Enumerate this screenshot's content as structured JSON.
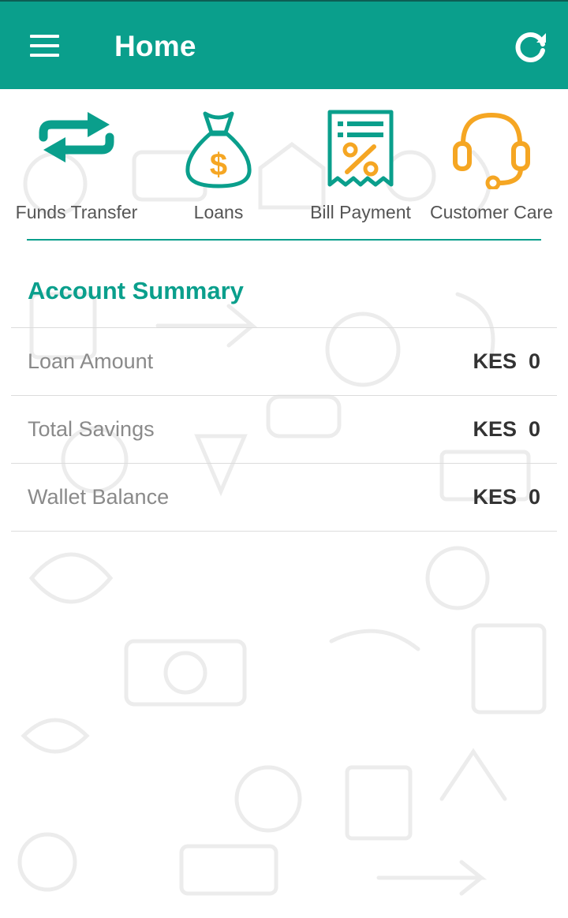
{
  "appbar": {
    "title": "Home",
    "color": "#0a9f8c",
    "menu_icon": "hamburger-icon",
    "refresh_icon": "refresh-icon"
  },
  "shortcuts": [
    {
      "label": "Funds Transfer",
      "icon": "transfer-arrows-icon",
      "color": "#0a9f8c"
    },
    {
      "label": "Loans",
      "icon": "money-bag-icon",
      "color": "#0a9f8c"
    },
    {
      "label": "Bill Payment",
      "icon": "receipt-percent-icon",
      "color": "#0a9f8c"
    },
    {
      "label": "Customer Care",
      "icon": "headset-icon",
      "color": "#f5a623"
    }
  ],
  "summary": {
    "title": "Account Summary",
    "rows": [
      {
        "label": "Loan Amount",
        "value": "KES  0"
      },
      {
        "label": "Total Savings",
        "value": "KES  0"
      },
      {
        "label": "Wallet Balance",
        "value": "KES  0"
      }
    ]
  },
  "colors": {
    "accent": "#0a9f8c",
    "orange": "#f5a623"
  }
}
